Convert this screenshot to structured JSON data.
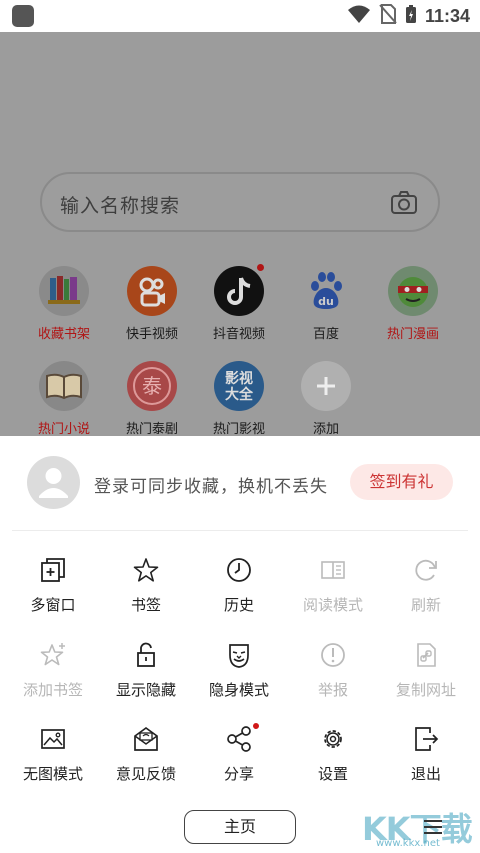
{
  "status_bar": {
    "time": "11:34"
  },
  "search": {
    "placeholder": "输入名称搜索"
  },
  "quick_access": [
    {
      "label": "收藏书架",
      "highlight": true
    },
    {
      "label": "快手视频",
      "highlight": false
    },
    {
      "label": "抖音视频",
      "highlight": false,
      "dot": true
    },
    {
      "label": "百度",
      "highlight": false
    },
    {
      "label": "热门漫画",
      "highlight": true
    },
    {
      "label": "热门小说",
      "highlight": true
    },
    {
      "label": "热门泰剧",
      "highlight": false
    },
    {
      "label": "热门影视",
      "highlight": false
    },
    {
      "label": "添加",
      "highlight": false
    }
  ],
  "quick_access_icon_text": {
    "baidu": "du",
    "thai": "泰",
    "movie_line1": "影视",
    "movie_line2": "大全"
  },
  "login": {
    "text": "登录可同步收藏，换机不丢失",
    "checkin_label": "签到有礼"
  },
  "menu": [
    {
      "label": "多窗口",
      "enabled": true,
      "icon": "multi-window-icon"
    },
    {
      "label": "书签",
      "enabled": true,
      "icon": "star-icon"
    },
    {
      "label": "历史",
      "enabled": true,
      "icon": "clock-icon"
    },
    {
      "label": "阅读模式",
      "enabled": false,
      "icon": "book-icon"
    },
    {
      "label": "刷新",
      "enabled": false,
      "icon": "refresh-icon"
    },
    {
      "label": "添加书签",
      "enabled": false,
      "icon": "star-plus-icon"
    },
    {
      "label": "显示隐藏",
      "enabled": true,
      "icon": "unlock-icon"
    },
    {
      "label": "隐身模式",
      "enabled": true,
      "icon": "mask-icon"
    },
    {
      "label": "举报",
      "enabled": false,
      "icon": "report-icon"
    },
    {
      "label": "复制网址",
      "enabled": false,
      "icon": "copy-link-icon"
    },
    {
      "label": "无图模式",
      "enabled": true,
      "icon": "image-icon"
    },
    {
      "label": "意见反馈",
      "enabled": true,
      "icon": "feedback-icon"
    },
    {
      "label": "分享",
      "enabled": true,
      "icon": "share-icon",
      "dot": true
    },
    {
      "label": "设置",
      "enabled": true,
      "icon": "gear-icon"
    },
    {
      "label": "退出",
      "enabled": true,
      "icon": "exit-icon"
    }
  ],
  "bottom_bar": {
    "home_label": "主页"
  },
  "watermark": {
    "main": "KK下载",
    "url": "www.kkx.net"
  },
  "colors": {
    "accent_red": "#b01515",
    "checkin_bg": "#fde8e6",
    "checkin_text": "#cc3333",
    "disabled": "#b6b6b6"
  }
}
